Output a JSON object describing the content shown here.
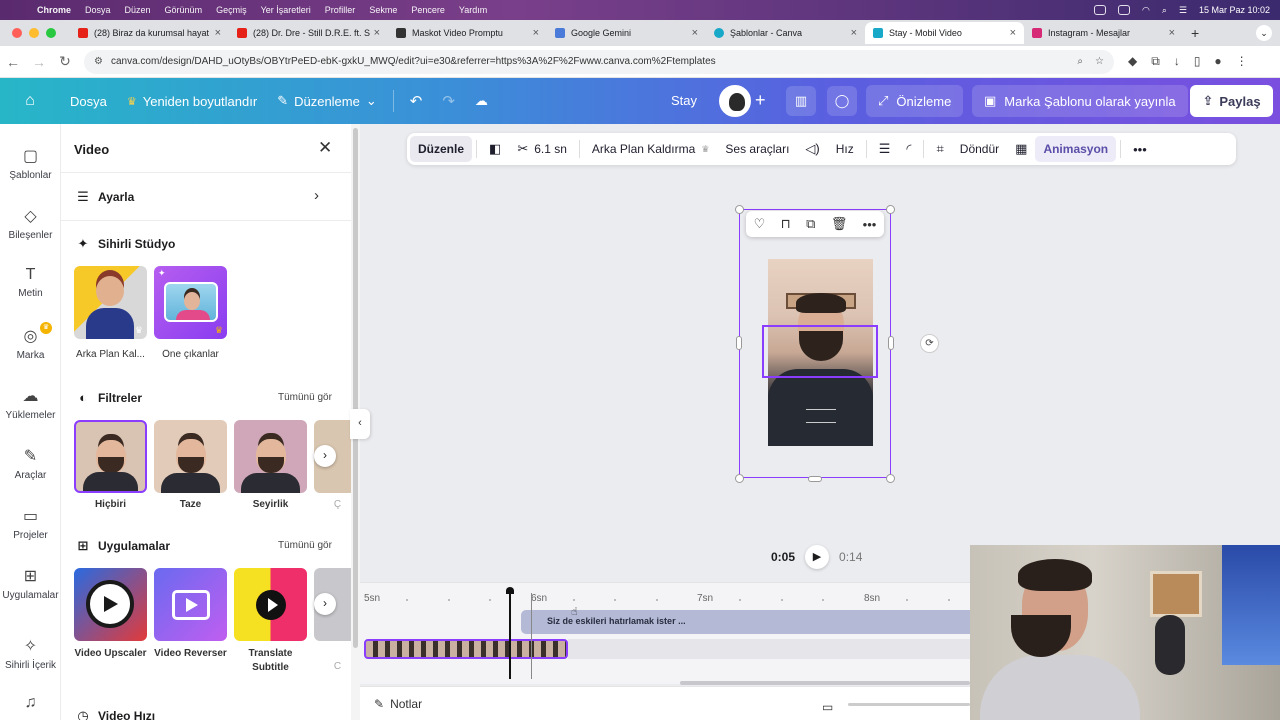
{
  "menubar": {
    "app": "Chrome",
    "items": [
      "Dosya",
      "Düzen",
      "Görünüm",
      "Geçmiş",
      "Yer İşaretleri",
      "Profiller",
      "Sekme",
      "Pencere",
      "Yardım"
    ],
    "clock": "15 Mar Paz  10:02"
  },
  "tabs": [
    {
      "title": "(28) Biraz da kurumsal hayat",
      "color": "#e62117"
    },
    {
      "title": "(28) Dr. Dre - Still D.R.E. ft. S",
      "color": "#e62117"
    },
    {
      "title": "Maskot Video Promptu",
      "color": "#333333"
    },
    {
      "title": "Google Gemini",
      "color": "#4a7bd8"
    },
    {
      "title": "Şablonlar - Canva",
      "color": "#18a8c8"
    },
    {
      "title": "Stay - Mobil Video",
      "color": "#18a8c8"
    },
    {
      "title": "Instagram - Mesajlar",
      "color": "#d62976"
    }
  ],
  "address": {
    "url": "canva.com/design/DAHD_uOtyBs/OBYtrPeED-ebK-gxkU_MWQ/edit?ui=e30&referrer=https%3A%2F%2Fwww.canva.com%2Ftemplates"
  },
  "header": {
    "file": "Dosya",
    "resize": "Yeniden boyutlandır",
    "edit": "Düzenleme",
    "design_title": "Stay",
    "preview": "Önizleme",
    "publish_template": "Marka Şablonu olarak yayınla",
    "share": "Paylaş"
  },
  "rail": [
    {
      "label": "Şablonlar",
      "icon": "▢"
    },
    {
      "label": "Bileşenler",
      "icon": "◇"
    },
    {
      "label": "Metin",
      "icon": "T"
    },
    {
      "label": "Marka",
      "icon": "◎"
    },
    {
      "label": "Yüklemeler",
      "icon": "☁"
    },
    {
      "label": "Araçlar",
      "icon": "✎"
    },
    {
      "label": "Projeler",
      "icon": "▭"
    },
    {
      "label": "Uygulamalar",
      "icon": "⊞"
    },
    {
      "label": "Sihirli İçerik",
      "icon": "✧"
    }
  ],
  "panel": {
    "title": "Video",
    "adjust": "Ayarla",
    "magic_studio": "Sihirli Stüdyo",
    "magic_items": [
      "Arka Plan Kal...",
      "Öne çıkanlar"
    ],
    "filters": "Filtreler",
    "see_all": "Tümünü gör",
    "filter_items": [
      "Hiçbiri",
      "Taze",
      "Seyirlik",
      "Ç"
    ],
    "apps": "Uygulamalar",
    "app_items": [
      "Video Upscaler",
      "Video Reverser",
      "Translate Subtitle",
      "C"
    ],
    "video_speed": "Video Hızı"
  },
  "toolbar": {
    "edit": "Düzenle",
    "duration": "6.1 sn",
    "bg_remove": "Arka Plan Kaldırma",
    "audio": "Ses araçları",
    "speed": "Hız",
    "rotate": "Döndür",
    "animation": "Animasyon"
  },
  "playback": {
    "current": "0:05",
    "total": "0:14"
  },
  "timeline": {
    "ticks": [
      "5sn",
      "6sn",
      "7sn",
      "8sn"
    ],
    "text_clip": "Siz de eskileri hatırlamak ister ..."
  },
  "footer": {
    "notes": "Notlar"
  }
}
